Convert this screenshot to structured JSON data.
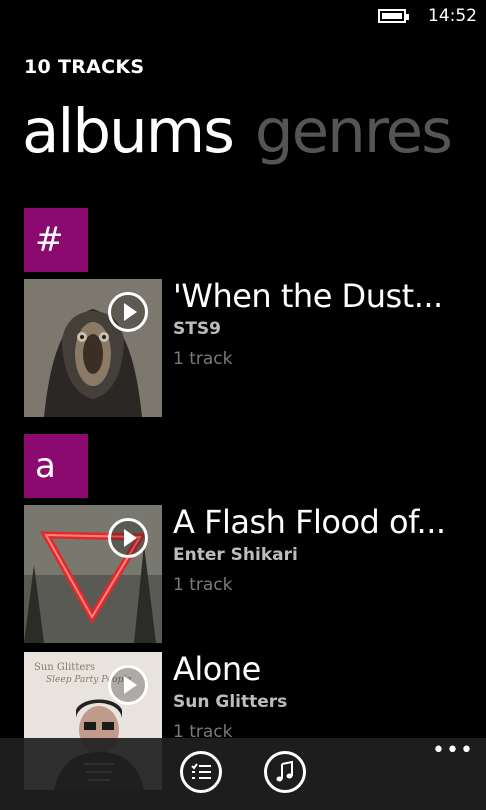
{
  "status": {
    "time": "14:52"
  },
  "header": {
    "title": "10 TRACKS"
  },
  "pivot": {
    "tabs": [
      {
        "label": "albums"
      },
      {
        "label": "genres"
      }
    ]
  },
  "groups": [
    {
      "letter": "#"
    },
    {
      "letter": "a"
    }
  ],
  "albums": [
    {
      "title": "'When the Dust...",
      "artist": "STS9",
      "tracks": "1 track"
    },
    {
      "title": "A Flash Flood of...",
      "artist": "Enter Shikari",
      "tracks": "1 track"
    },
    {
      "title": "Alone",
      "artist": "Sun Glitters",
      "tracks": "1 track",
      "art_text": "Sun Glitters",
      "art_subtext": "Sleep Party People"
    }
  ],
  "app_bar": {
    "more": "•••"
  },
  "colors": {
    "accent": "#8b0a70",
    "background": "#000000",
    "app_bar": "#1f1f1f"
  },
  "icons": {
    "play": "play-circle-icon",
    "queue": "queue-list-icon",
    "music": "music-note-icon",
    "more": "ellipsis-icon"
  }
}
